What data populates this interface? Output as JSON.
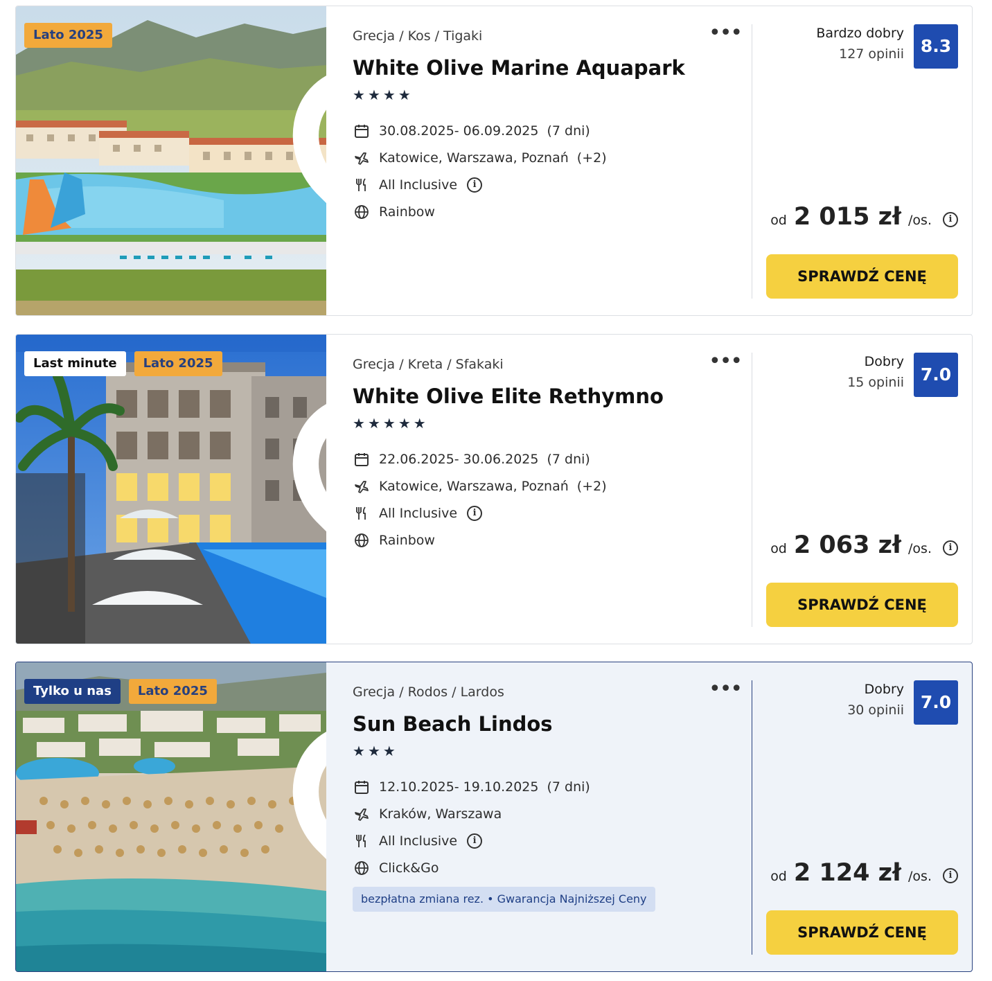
{
  "colors": {
    "season_badge": "#f2a93b",
    "exclusive_badge": "#1f3f85",
    "rating_box": "#1f4cb0",
    "cta_button": "#f5d040",
    "perks_bg": "#d3def2"
  },
  "icons": {
    "date": "calendar-icon",
    "flight": "plane-icon",
    "board": "fork-knife-icon",
    "operator": "globe-icon",
    "favorite": "heart-icon",
    "more": "more-dots-icon",
    "info": "info-icon"
  },
  "offers": [
    {
      "badges": [
        {
          "label": "Lato 2025",
          "type": "season"
        }
      ],
      "location": {
        "country": "Grecja",
        "region": "Kos",
        "city": "Tigaki"
      },
      "name": "White Olive Marine Aquapark",
      "stars": 4,
      "dates": "30.08.2025- 06.09.2025",
      "duration": "(7 dni)",
      "departures": "Katowice, Warszawa, Poznań",
      "departures_extra": "(+2)",
      "board": "All Inclusive",
      "operator": "Rainbow",
      "rating_label": "Bardzo dobry",
      "rating_count": "127 opinii",
      "rating_score": "8.3",
      "price_prefix": "od",
      "price": "2 015 zł",
      "price_unit": "/os.",
      "cta": "SPRAWDŹ CENĘ"
    },
    {
      "badges": [
        {
          "label": "Last minute",
          "type": "lastminute"
        },
        {
          "label": "Lato 2025",
          "type": "season"
        }
      ],
      "location": {
        "country": "Grecja",
        "region": "Kreta",
        "city": "Sfakaki"
      },
      "name": "White Olive Elite Rethymno",
      "stars": 5,
      "dates": "22.06.2025- 30.06.2025",
      "duration": "(7 dni)",
      "departures": "Katowice, Warszawa, Poznań",
      "departures_extra": "(+2)",
      "board": "All Inclusive",
      "operator": "Rainbow",
      "rating_label": "Dobry",
      "rating_count": "15 opinii",
      "rating_score": "7.0",
      "price_prefix": "od",
      "price": "2 063 zł",
      "price_unit": "/os.",
      "cta": "SPRAWDŹ CENĘ"
    },
    {
      "badges": [
        {
          "label": "Tylko u nas",
          "type": "exclusive"
        },
        {
          "label": "Lato 2025",
          "type": "season"
        }
      ],
      "location": {
        "country": "Grecja",
        "region": "Rodos",
        "city": "Lardos"
      },
      "name": "Sun Beach Lindos",
      "stars": 3,
      "dates": "12.10.2025- 19.10.2025",
      "duration": "(7 dni)",
      "departures": "Kraków, Warszawa",
      "board": "All Inclusive",
      "operator": "Click&Go",
      "perks": "bezpłatna zmiana rez. • Gwarancja Najniższej Ceny",
      "rating_label": "Dobry",
      "rating_count": "30 opinii",
      "rating_score": "7.0",
      "price_prefix": "od",
      "price": "2 124 zł",
      "price_unit": "/os.",
      "cta": "SPRAWDŹ CENĘ"
    }
  ]
}
